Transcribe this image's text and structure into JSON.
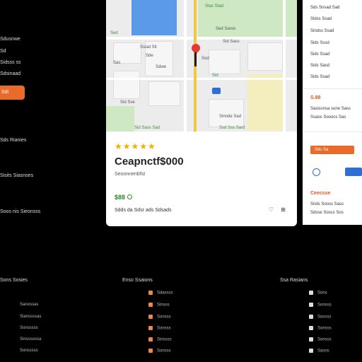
{
  "left": {
    "lines": [
      "Sdusnwe",
      "Sd",
      "Sidsss ss",
      "Sdsinaad"
    ],
    "cta_label": "Sdi",
    "sections": [
      "Sds Rianies",
      "Sisits Siasnses",
      "Soos nis Sieonsss"
    ]
  },
  "map": {
    "labels": [
      "Stas Stad",
      "Sed Saroo",
      "Sed",
      "Ssiad Sit",
      "Sde",
      "Sas",
      "Sid Sass",
      "Sdwe",
      "Sod",
      "Sid",
      "Sid Sse",
      "Sinnde Sad",
      "Sid Sass Sad",
      "Ssd Sss Sard"
    ]
  },
  "card": {
    "stars": "★★★★★",
    "title": "Ceapnctf$000",
    "subtitle": "Seoonnenbfst",
    "rating_value": "$88",
    "address": "Sdds da Sdsr ads Sdsads",
    "action_icons": "♡ ⊞"
  },
  "right": {
    "list": [
      "Sds Snsad Sad",
      "Sidss Ssad",
      "Sindss Ssad",
      "Sids Sssd",
      "Sids Ssad",
      "Sids Sasd",
      "Sids Ssad",
      "Sds Ssaad"
    ],
    "highlight_1": "S.88",
    "meta_1": "Sasissnsa sune Sass",
    "meta_2": "Ssaos Sooocs Sas",
    "bar_label": "Sds Sa",
    "highlight_2": "Ceecsse",
    "meta_3": "Snds Sooss Sass",
    "meta_4": "Sdsse Soscs Sos"
  },
  "footer": {
    "col1": {
      "heading": "Sons Sosies",
      "items": [
        "Sanossas",
        "Sianssssas",
        "Sonsssss",
        "Sinsssossa",
        "Sonsssss"
      ]
    },
    "col2": {
      "heading": "Enso Ssaions",
      "items": [
        "Sdassss",
        "Sinsss",
        "Sonsss",
        "Sonsss",
        "Sinssss",
        "Sonsss"
      ]
    },
    "col3": {
      "heading": "Ssa Rasians",
      "items": [
        "Sons",
        "Sonsss",
        "Sossss",
        "Sonsss",
        "Sonsss",
        "Sasns"
      ]
    }
  }
}
